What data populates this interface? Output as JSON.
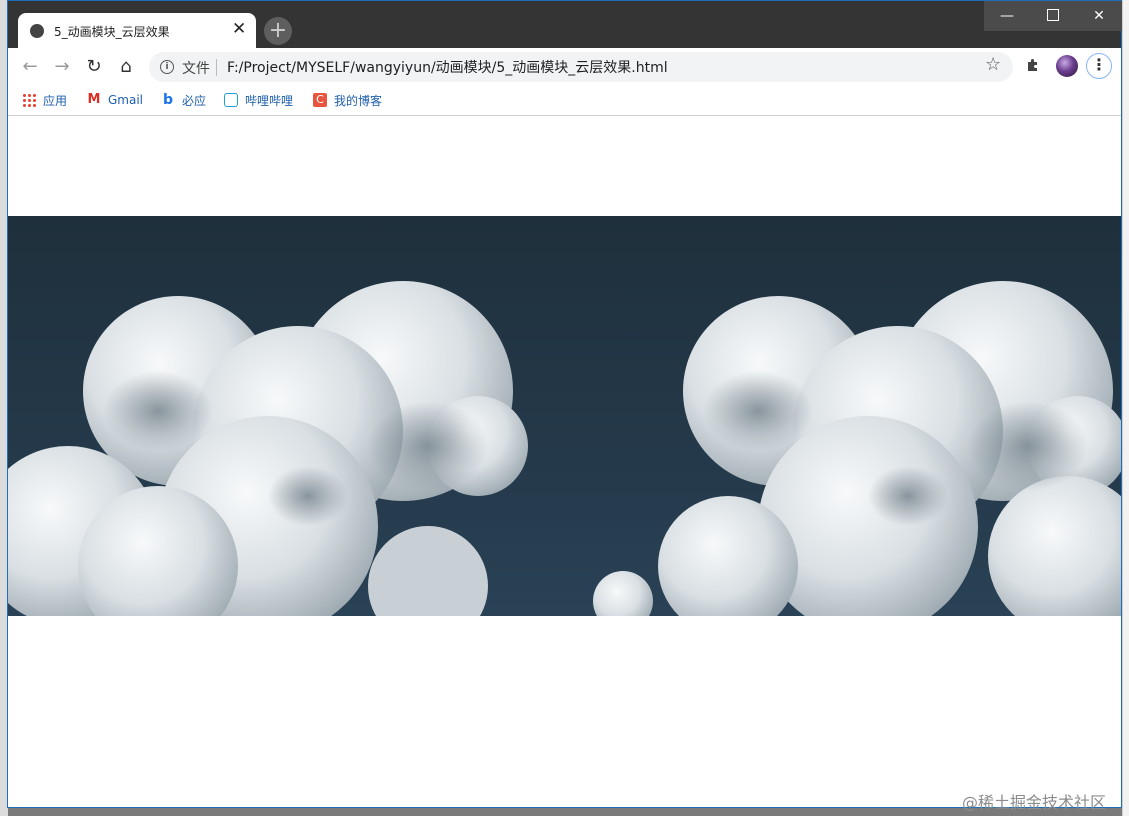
{
  "browser": {
    "tab_title": "5_动画模块_云层效果",
    "tab_close": "✕",
    "new_tab": "+",
    "window_controls": {
      "minimize": "—",
      "close": "✕"
    },
    "nav": {
      "back": "←",
      "forward": "→",
      "reload": "↻",
      "home": "⌂"
    },
    "omnibox": {
      "info_icon": "i",
      "file_label": "文件",
      "url": "F:/Project/MYSELF/wangyiyun/动画模块/5_动画模块_云层效果.html",
      "star_icon": "☆"
    },
    "menu_icon": "⋮",
    "bookmarks": [
      {
        "label": "应用",
        "icon": "apps-icon"
      },
      {
        "label": "Gmail",
        "icon": "gmail-icon"
      },
      {
        "label": "必应",
        "icon": "bing-icon"
      },
      {
        "label": "哔哩哔哩",
        "icon": "bilibili-icon"
      },
      {
        "label": "我的博客",
        "icon": "blog-icon"
      }
    ]
  },
  "page": {
    "scene": "cloud-layer",
    "sky_color": "#21323f"
  },
  "watermark": "@稀土掘金技术社区"
}
